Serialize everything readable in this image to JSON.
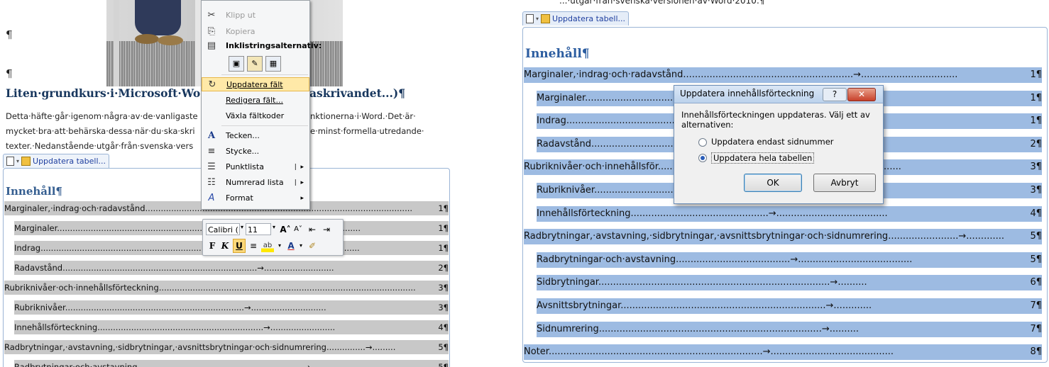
{
  "left_doc": {
    "pilcrow": "¶",
    "heading": "Liten·grundkurs·i·Microsoft·Wo",
    "heading_tail": "askrivandet...)¶",
    "body_lines": [
      "Detta·häfte·går·igenom·några·av·de·vanligaste",
      "mycket·bra·att·behärska·dessa·när·du·ska·skri",
      "texter.·Nedanstående·utgår·från·svenska·vers"
    ],
    "body_tails": [
      "nktionerna·i·Word.·Det·är·",
      "e·minst·formella·utredande·",
      ""
    ],
    "toc_tab_label": "Uppdatera tabell...",
    "toc_title": "Innehåll¶",
    "toc": [
      {
        "text": "Marginaler,·indrag·och·radavstånd",
        "leader": ".......................................................................................................",
        "page": "1¶"
      },
      {
        "text": "Marginaler",
        "leader": ".....................................................................................................................",
        "page": "1¶"
      },
      {
        "text": "Indrag",
        "leader": "...........................................................................................................................",
        "page": "1¶"
      },
      {
        "text": "Radavstånd",
        "leader": "...........................................................................→...........................",
        "page": "2¶"
      },
      {
        "text": "Rubriknivåer·och·innehållsförteckning",
        "leader": "...................................................................................................",
        "page": "3¶"
      },
      {
        "text": "Rubriknivåer",
        "leader": ".....................................................................→.............................",
        "page": "3¶"
      },
      {
        "text": "Innehållsförteckning",
        "leader": "................................................................→.........................",
        "page": "4¶"
      },
      {
        "text": "Radbrytningar,·avstavning,·sidbrytningar,·avsnittsbrytningar·och·sidnumrering",
        "leader": "...............→.........",
        "page": "5¶"
      },
      {
        "text": "Radbrytningar·och·avstavning",
        "leader": "................................................................→..................",
        "page": "5¶"
      }
    ]
  },
  "context_menu": {
    "items": [
      {
        "label": "Klipp ut",
        "icon": "scissors-icon",
        "glyph": "✂",
        "disabled": true
      },
      {
        "label": "Kopiera",
        "icon": "copy-icon",
        "glyph": "⎘",
        "disabled": true
      },
      {
        "label": "Inklistringsalternativ:",
        "icon": "paste-icon",
        "glyph": "📋",
        "bold": true
      },
      {
        "label": "Uppdatera fält",
        "icon": "update-field-icon",
        "glyph": "↻",
        "highlight": true
      },
      {
        "label": "Redigera fält...",
        "icon": "",
        "glyph": ""
      },
      {
        "label": "Växla fältkoder",
        "icon": "",
        "glyph": ""
      },
      {
        "label": "Tecken...",
        "icon": "font-icon",
        "glyph": "A"
      },
      {
        "label": "Stycke...",
        "icon": "paragraph-icon",
        "glyph": "≡"
      },
      {
        "label": "Punktlista",
        "icon": "bullet-list-icon",
        "glyph": "☰",
        "submenu": true
      },
      {
        "label": "Numrerad lista",
        "icon": "numbered-list-icon",
        "glyph": "☷",
        "submenu": true
      },
      {
        "label": "Format",
        "icon": "styles-icon",
        "glyph": "A",
        "submenu": true
      }
    ]
  },
  "mini_toolbar": {
    "font": "Calibri (B",
    "size": "11",
    "grow_font": "A˄",
    "shrink_font": "A˅",
    "bold": "F",
    "italic": "K",
    "underline": "U"
  },
  "right_doc": {
    "top_text": "...·utgår·från·svenska·versionen·av·Word·2010.¶",
    "toc_tab_label": "Uppdatera tabell...",
    "toc_title": "Innehåll¶",
    "toc": [
      {
        "text": "Marginaler,·indrag·och·radavstånd",
        "leader": "..........................................................→.................................",
        "page": "1¶",
        "indent": false
      },
      {
        "text": "Marginaler",
        "leader": "...........................................................................................",
        "page": "1¶",
        "indent": true
      },
      {
        "text": "Indrag",
        "leader": ".................................................................................................",
        "page": "1¶",
        "indent": true
      },
      {
        "text": "Radavstånd",
        "leader": "........................................................................................",
        "page": "2¶",
        "indent": true
      },
      {
        "text": "Rubriknivåer·och·innehållsför",
        "leader": "...................................................................................",
        "page": "3¶",
        "indent": false
      },
      {
        "text": "Rubriknivåer",
        "leader": "......................................................................................",
        "page": "3¶",
        "indent": true
      },
      {
        "text": "Innehållsförteckning",
        "leader": "...............................................→......................................",
        "page": "4¶",
        "indent": true
      },
      {
        "text": "Radbrytningar,·avstavning,·sidbrytningar,·avsnittsbrytningar·och·sidnumrering",
        "leader": "........................→.............",
        "page": "5¶",
        "indent": false
      },
      {
        "text": "Radbrytningar·och·avstavning",
        "leader": ".......................................→.......................................",
        "page": "5¶",
        "indent": true
      },
      {
        "text": "Sidbrytningar",
        "leader": "...............................................................................→..........",
        "page": "6¶",
        "indent": true
      },
      {
        "text": "Avsnittsbrytningar",
        "leader": "......................................................................→.............",
        "page": "7¶",
        "indent": true
      },
      {
        "text": "Sidnumrering",
        "leader": "............................................................................→..........",
        "page": "7¶",
        "indent": true
      },
      {
        "text": "Noter",
        "leader": ".........................................................................→..........................................",
        "page": "8¶",
        "indent": false
      }
    ]
  },
  "dialog": {
    "title": "Uppdatera innehållsförteckning",
    "help": "?",
    "close": "✕",
    "message": "Innehållsförteckningen uppdateras. Välj ett av alternativen:",
    "option_page_numbers": "Uppdatera endast sidnummer",
    "option_whole_table": "Uppdatera hela tabellen",
    "selected": "whole_table",
    "ok": "OK",
    "cancel": "Avbryt"
  }
}
